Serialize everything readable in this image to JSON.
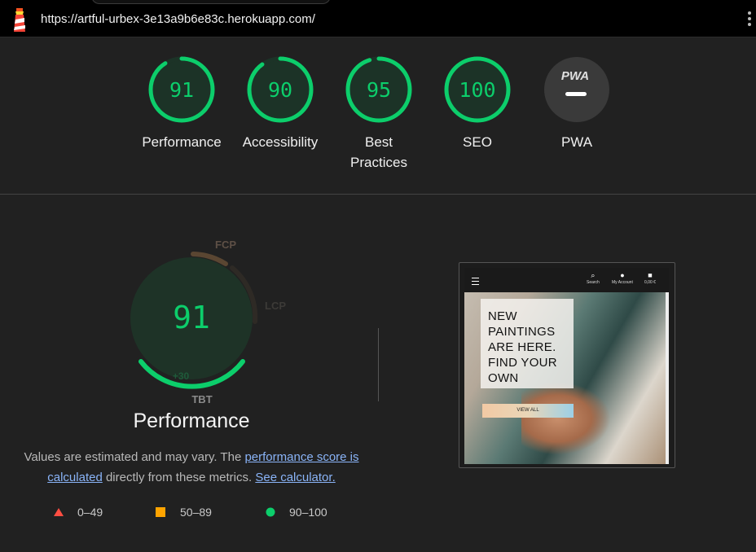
{
  "browser": {
    "url": "https://artful-urbex-3e13a9b6e83c.herokuapp.com/"
  },
  "categories": [
    {
      "label": "Performance",
      "score": "91",
      "value": 91,
      "color": "#0cce6b"
    },
    {
      "label": "Accessibility",
      "score": "90",
      "value": 90,
      "color": "#0cce6b"
    },
    {
      "label": "Best Practices",
      "score": "95",
      "value": 95,
      "color": "#0cce6b"
    },
    {
      "label": "SEO",
      "score": "100",
      "value": 100,
      "color": "#0cce6b"
    },
    {
      "label": "PWA",
      "badge": "PWA",
      "color": "#9e9e9e"
    }
  ],
  "performance": {
    "score": "91",
    "title": "Performance",
    "metrics": [
      {
        "abbr": "FCP"
      },
      {
        "abbr": "LCP"
      },
      {
        "abbr": "TBT"
      },
      {
        "abbr": "+30"
      }
    ],
    "desc_prefix": "Values are estimated and may vary. The ",
    "desc_link1": "performance score is calculated",
    "desc_middle": " directly from these metrics. ",
    "desc_link2": "See calculator."
  },
  "legend": [
    {
      "range": "0–49",
      "color": "#ff4e42",
      "shape": "triangle"
    },
    {
      "range": "50–89",
      "color": "#ffa400",
      "shape": "square"
    },
    {
      "range": "90–100",
      "color": "#0cce6b",
      "shape": "circle"
    }
  ],
  "screenshot": {
    "nav": {
      "search": "Search",
      "account": "My Account",
      "bag": "0,00 €"
    },
    "hero_lines": [
      "NEW",
      "PAINTINGS",
      "ARE HERE.",
      "FIND YOUR",
      "OWN"
    ],
    "button": "VIEW ALL"
  }
}
